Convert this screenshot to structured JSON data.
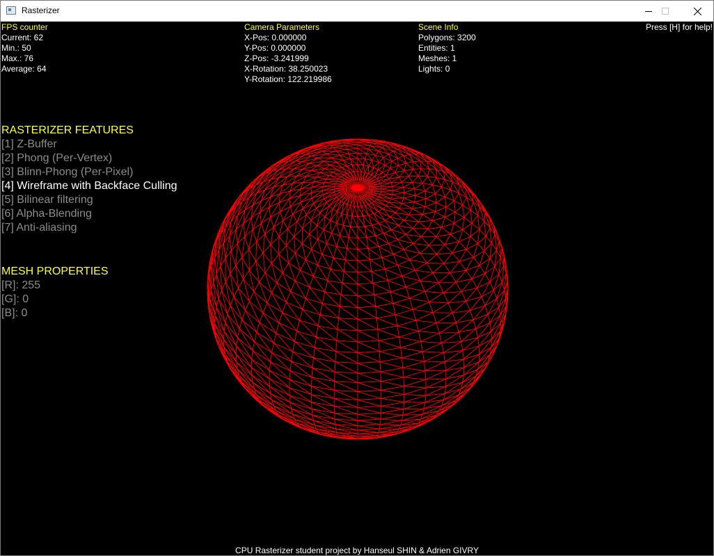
{
  "window": {
    "title": "Rasterizer",
    "app_icon": "window-app-icon",
    "controls": [
      "minimize-icon",
      "maximize-icon",
      "close-icon"
    ]
  },
  "fps": {
    "title": "FPS counter",
    "current": "Current: 62",
    "min": "Min.: 50",
    "max": "Max.: 76",
    "average": "Average: 64"
  },
  "camera": {
    "title": "Camera Parameters",
    "x_pos": "X-Pos: 0.000000",
    "y_pos": "Y-Pos: 0.000000",
    "z_pos": "Z-Pos: -3.241999",
    "x_rot": "X-Rotation: 38.250023",
    "y_rot": "Y-Rotation: 122.219986"
  },
  "scene": {
    "title": "Scene Info",
    "polygons": "Polygons: 3200",
    "entities": "Entities: 1",
    "meshes": "Meshes: 1",
    "lights": "Lights: 0"
  },
  "help": "Press [H] for help!",
  "features": {
    "title": "RASTERIZER FEATURES",
    "items": [
      {
        "label": "[1] Z-Buffer",
        "active": false
      },
      {
        "label": "[2] Phong (Per-Vertex)",
        "active": false
      },
      {
        "label": "[3] Blinn-Phong (Per-Pixel)",
        "active": false
      },
      {
        "label": "[4] Wireframe with Backface Culling",
        "active": true
      },
      {
        "label": "[5] Bilinear filtering",
        "active": false
      },
      {
        "label": "[6] Alpha-Blending",
        "active": false
      },
      {
        "label": "[7] Anti-aliasing",
        "active": false
      }
    ]
  },
  "mesh": {
    "title": "MESH PROPERTIES",
    "r": "[R]: 255",
    "g": "[G]: 0",
    "b": "[B]: 0"
  },
  "colors": {
    "wireframe": "#ff0000",
    "hud_heading": "#ffff33",
    "hud_text": "#ffffff",
    "inactive_feature": "#8c8c8c",
    "background": "#000000"
  },
  "credits": "CPU Rasterizer student project by Hanseul SHIN & Adrien GIVRY"
}
